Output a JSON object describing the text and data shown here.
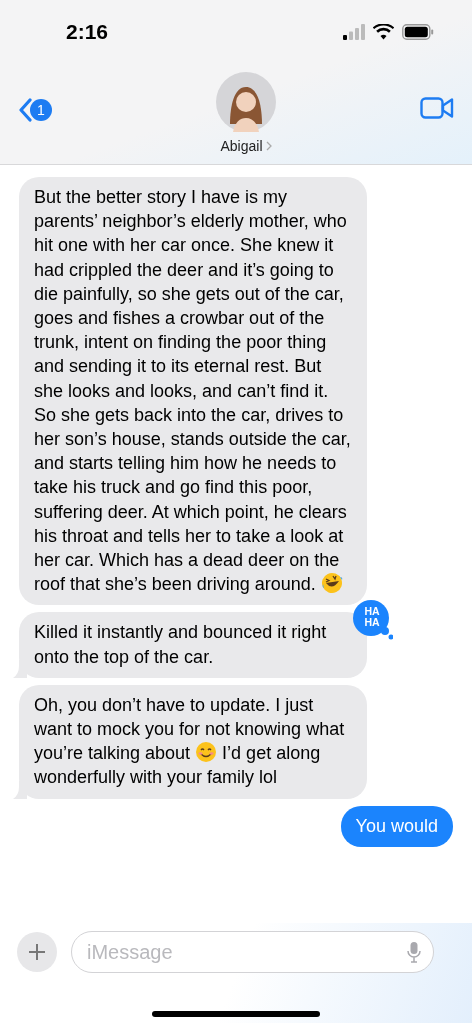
{
  "status_bar": {
    "time": "2:16"
  },
  "header": {
    "back_badge": "1",
    "contact_name": "Abigail"
  },
  "messages": [
    {
      "kind": "received",
      "tail": false,
      "segments": [
        {
          "kind": "text",
          "text": "But the better story I have is my parents’ neighbor’s elderly mother, who hit one with her car once. She knew it had crippled the deer and it’s going to die painfully, so she gets out of the car, goes and fishes a crowbar out of the trunk, intent on finding the poor thing and sending it to its eternal rest. But she looks and looks, and can’t find it. So she gets back into the car, drives to her son’s house, stands outside the car, and starts telling him how he needs to take his truck and go find this poor, suffering deer. At which point, he clears his throat and tells her to take a look at her car. Which has a dead deer on the roof that she’s been driving around. "
        },
        {
          "kind": "laugh-emoji"
        }
      ]
    },
    {
      "kind": "received",
      "tail": true,
      "segments": [
        {
          "kind": "text",
          "text": "Killed it instantly and bounced it right onto the top of the car."
        }
      ],
      "reaction": "HA HA"
    },
    {
      "kind": "received",
      "tail": true,
      "segments": [
        {
          "kind": "text",
          "text": "Oh, you don’t have to update. I just want to mock you for not knowing what you’re talking about "
        },
        {
          "kind": "smile-emoji"
        },
        {
          "kind": "text",
          "text": " I’d get along wonderfully with your family lol"
        }
      ]
    },
    {
      "kind": "sent",
      "tail": false,
      "segments": [
        {
          "kind": "text",
          "text": "You would"
        }
      ]
    }
  ],
  "compose": {
    "placeholder": "iMessage"
  }
}
